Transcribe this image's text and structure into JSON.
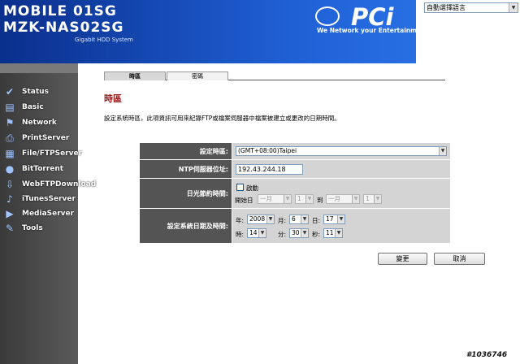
{
  "header": {
    "line1": "MOBILE 01SG",
    "line2": "MZK-NAS02SG",
    "subtitle": "Gigabit HDD System",
    "logo_text": "PCi",
    "slogan": "We Network your Entertainment.",
    "language_select": "自動選擇語言"
  },
  "sidebar": {
    "items": [
      {
        "label": "Status",
        "icon": "✔"
      },
      {
        "label": "Basic",
        "icon": "▤"
      },
      {
        "label": "Network",
        "icon": "⚑"
      },
      {
        "label": "PrintServer",
        "icon": "⎙"
      },
      {
        "label": "File/FTPServer",
        "icon": "▦"
      },
      {
        "label": "BitTorrent",
        "icon": "●"
      },
      {
        "label": "WebFTPDownload",
        "icon": "⇩"
      },
      {
        "label": "iTunesServer",
        "icon": "♪"
      },
      {
        "label": "MediaServer",
        "icon": "▶"
      },
      {
        "label": "Tools",
        "icon": "✎"
      }
    ]
  },
  "tabs": [
    {
      "label": "時區",
      "active": true
    },
    {
      "label": "密碼",
      "active": false
    }
  ],
  "page": {
    "title": "時區",
    "description": "設定系統時區，此項資訊可用來紀錄FTP或檔案伺服器中檔案被建立或更改的日期時間。"
  },
  "form": {
    "timezone": {
      "label": "設定時區:",
      "value": "(GMT+08:00)Taipei"
    },
    "ntp": {
      "label": "NTP伺服器位址:",
      "value": "192.43.244.18"
    },
    "dst": {
      "label": "日光節約時間:",
      "enable_label": "啟動",
      "start_label": "開始日",
      "start_month": "一月",
      "start_day": "1",
      "to_label": "到",
      "end_month": "一月",
      "end_day": "1"
    },
    "datetime": {
      "label": "設定系統日期及時間:",
      "year_label": "年:",
      "year": "2008",
      "month_label": "月:",
      "month": "6",
      "day_label": "日:",
      "day": "17",
      "hour_label": "時:",
      "hour": "14",
      "minute_label": "分:",
      "minute": "30",
      "second_label": "秒:",
      "second": "11"
    }
  },
  "buttons": {
    "apply": "變更",
    "cancel": "取消"
  },
  "watermark": "#1036746"
}
